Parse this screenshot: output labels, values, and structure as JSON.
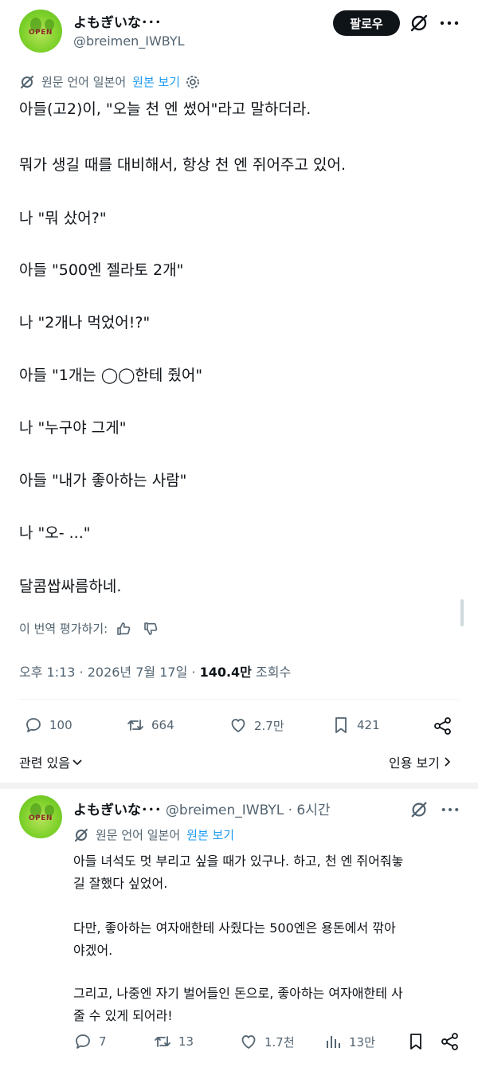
{
  "author": {
    "name": "よもぎいな･･･",
    "handle": "@breimen_IWBYL",
    "avatar_text": "OPEN"
  },
  "follow_label": "팔로우",
  "translation_bar": {
    "text": "원문 언어 일본어",
    "link": "원본 보기"
  },
  "post_lines": [
    "아들(고2)이, \"오늘 천 엔 썼어\"라고 말하더라.",
    "뭐가 생길 때를 대비해서, 항상 천 엔 쥐어주고 있어.",
    "나 \"뭐 샀어?\"",
    "아들 \"500엔 젤라토 2개\"",
    "나 \"2개나 먹었어!?\"",
    "아들 \"1개는 ◯◯한테 줬어\"",
    "나 \"누구야 그게\"",
    "아들 \"내가 좋아하는 사람\"",
    "나 \"오- ...\"",
    "달콤쌉싸름하네."
  ],
  "rate_translation": "이 번역 평가하기:",
  "timestamp": "오후 1:13 · 2026년 7월 17일 · ",
  "views_count": "140.4만",
  "views_label": "조회수",
  "stats": {
    "replies": "100",
    "retweets": "664",
    "likes": "2.7만",
    "bookmarks": "421"
  },
  "related_label": "관련 있음",
  "quotes_label": "인용 보기",
  "reply": {
    "name": "よもぎいな･･･",
    "handle": "@breimen_IWBYL",
    "time": "· 6시간",
    "translation_text": "원문 언어 일본어",
    "translation_link": "원본 보기",
    "lines": [
      "아들 녀석도 멋 부리고 싶을 때가 있구나. 하고, 천 엔 쥐어줘놓",
      "길 잘했다 싶었어.",
      "다만, 좋아하는 여자애한테 사줬다는 500엔은 용돈에서 깎아",
      "야겠어.",
      "그리고, 나중엔 자기 벌어들인 돈으로, 좋아하는 여자애한테 사",
      "줄 수 있게 되어라!"
    ],
    "stats": {
      "replies": "7",
      "retweets": "13",
      "likes": "1.7천",
      "views": "13만"
    }
  },
  "icons": [
    "grok-icon",
    "translate-icon",
    "settings-icon",
    "thumbs-up-icon",
    "thumbs-down-icon",
    "reply-icon",
    "retweet-icon",
    "like-icon",
    "bookmark-icon",
    "share-icon",
    "views-icon",
    "chevron-down-icon",
    "chevron-right-icon",
    "more-icon"
  ]
}
